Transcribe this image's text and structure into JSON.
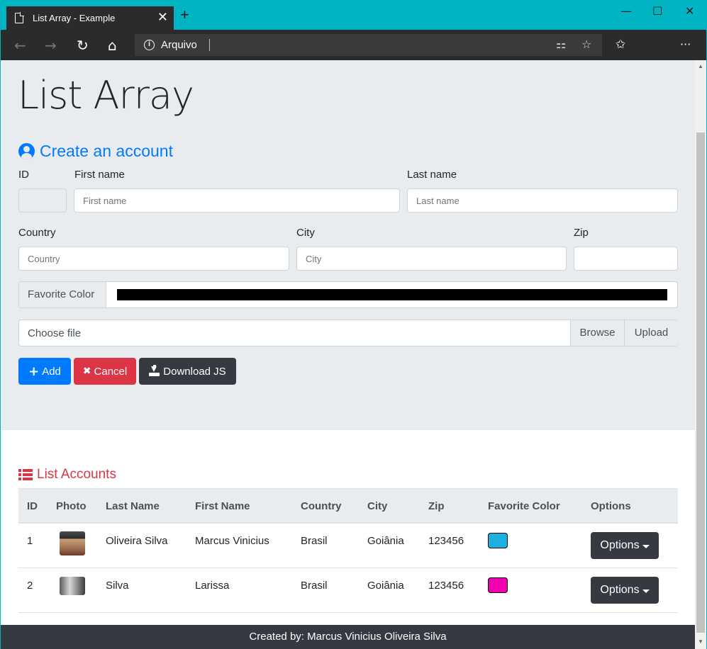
{
  "browser": {
    "tab_title": "List Array - Example",
    "tab_close": "✕",
    "new_tab": "+",
    "address": "Arquivo",
    "window_controls": {
      "minimize": "—",
      "maximize": "☐",
      "close": "✕"
    },
    "nav_icons": [
      "back-arrow-icon",
      "forward-arrow-icon",
      "refresh-icon",
      "home-icon"
    ],
    "more_menu": "···"
  },
  "page": {
    "title": "List Array",
    "form": {
      "heading": "Create an account",
      "labels": {
        "id": "ID",
        "first_name": "First name",
        "last_name": "Last name",
        "country": "Country",
        "city": "City",
        "zip": "Zip"
      },
      "placeholders": {
        "first_name": "First name",
        "last_name": "Last name",
        "country": "Country",
        "city": "City",
        "zip": ""
      },
      "favorite_color_label": "Favorite Color",
      "favorite_color_value": "#000000",
      "file_label": "Choose file",
      "browse_label": "Browse",
      "upload_label": "Upload",
      "buttons": {
        "add": "Add",
        "cancel": "Cancel",
        "download": "Download JS"
      }
    },
    "list": {
      "heading": "List Accounts",
      "columns": [
        "ID",
        "Photo",
        "Last Name",
        "First Name",
        "Country",
        "City",
        "Zip",
        "Favorite Color",
        "Options"
      ],
      "rows": [
        {
          "id": "1",
          "last_name": "Oliveira Silva",
          "first_name": "Marcus Vinicius",
          "country": "Brasil",
          "city": "Goiânia",
          "zip": "123456",
          "color": "#1ab0e0",
          "options": "Options"
        },
        {
          "id": "2",
          "last_name": "Silva",
          "first_name": "Larissa",
          "country": "Brasil",
          "city": "Goiânia",
          "zip": "123456",
          "color": "#f000b0",
          "options": "Options"
        }
      ]
    },
    "footer": "Created by: Marcus Vinicius Oliveira Silva"
  }
}
